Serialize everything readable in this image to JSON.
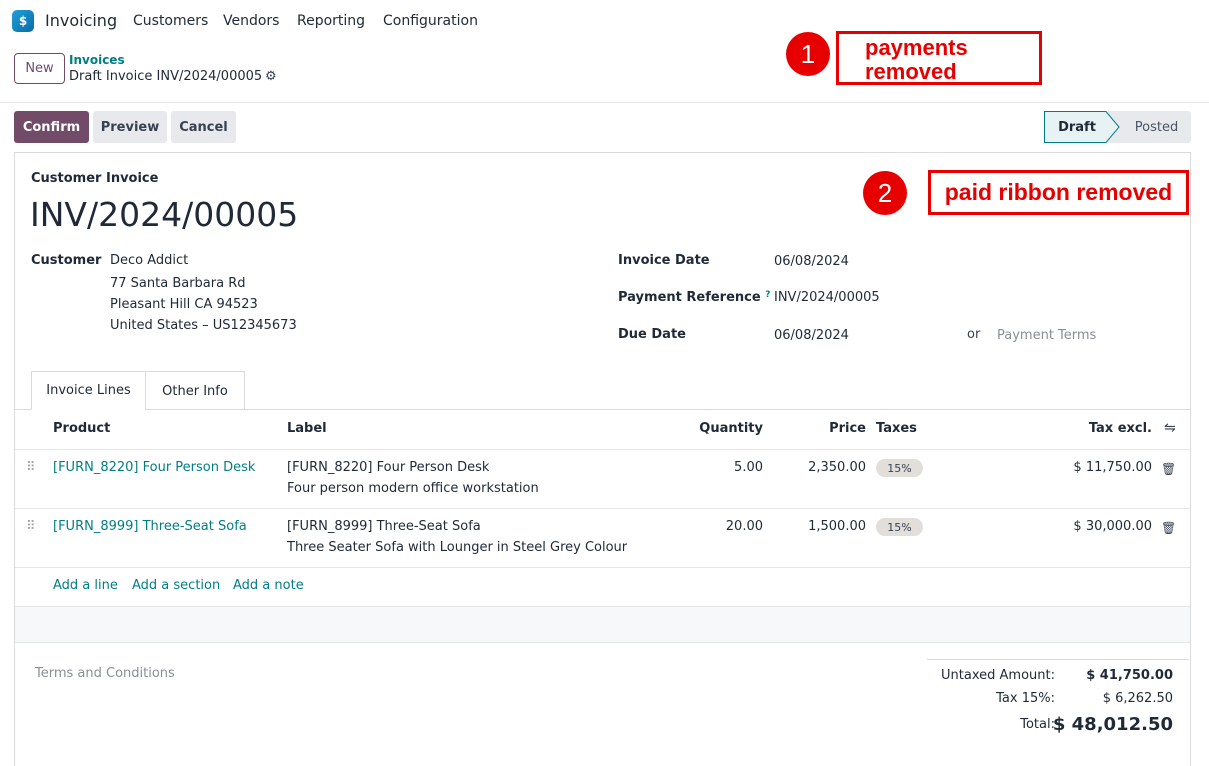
{
  "app": {
    "name": "Invoicing"
  },
  "menu": [
    "Customers",
    "Vendors",
    "Reporting",
    "Configuration"
  ],
  "control": {
    "new_label": "New",
    "breadcrumb_parent": "Invoices",
    "breadcrumb_current": "Draft Invoice INV/2024/00005"
  },
  "annotations": [
    {
      "number": "1",
      "text_line1": "payments",
      "text_line2": "removed"
    },
    {
      "number": "2",
      "text": "paid ribbon removed"
    }
  ],
  "actions": {
    "confirm": "Confirm",
    "preview": "Preview",
    "cancel": "Cancel"
  },
  "statusbar": {
    "draft": "Draft",
    "posted": "Posted",
    "active": "Draft"
  },
  "invoice": {
    "type": "Customer Invoice",
    "number": "INV/2024/00005",
    "customer_label": "Customer",
    "customer_name": "Deco Addict",
    "address_line1": "77 Santa Barbara Rd",
    "address_line2": "Pleasant Hill CA 94523",
    "address_line3": "United States – US12345673",
    "invoice_date_label": "Invoice Date",
    "invoice_date": "06/08/2024",
    "payment_ref_label": "Payment Reference",
    "payment_ref_help": "?",
    "payment_ref": "INV/2024/00005",
    "due_date_label": "Due Date",
    "due_date": "06/08/2024",
    "or_text": "or",
    "payment_terms_placeholder": "Payment Terms"
  },
  "tabs": [
    "Invoice Lines",
    "Other Info"
  ],
  "table": {
    "headers": {
      "product": "Product",
      "label": "Label",
      "quantity": "Quantity",
      "price": "Price",
      "taxes": "Taxes",
      "tax_excl": "Tax excl."
    },
    "rows": [
      {
        "product": "[FURN_8220] Four Person Desk",
        "label_line1": "[FURN_8220] Four Person Desk",
        "label_line2": "Four person modern office workstation",
        "quantity": "5.00",
        "price": "2,350.00",
        "tax": "15%",
        "subtotal": "$ 11,750.00"
      },
      {
        "product": "[FURN_8999] Three-Seat Sofa",
        "label_line1": "[FURN_8999] Three-Seat Sofa",
        "label_line2": "Three Seater Sofa with Lounger in Steel Grey Colour",
        "quantity": "20.00",
        "price": "1,500.00",
        "tax": "15%",
        "subtotal": "$ 30,000.00"
      }
    ],
    "add_line": "Add a line",
    "add_section": "Add a section",
    "add_note": "Add a note"
  },
  "footer": {
    "terms_placeholder": "Terms and Conditions",
    "untaxed_label": "Untaxed Amount:",
    "untaxed_value": "$ 41,750.00",
    "tax_label": "Tax 15%:",
    "tax_value": "$ 6,262.50",
    "total_label": "Total:",
    "total_value": "$ 48,012.50"
  },
  "colors": {
    "brand": "#714b67",
    "link": "#017e84",
    "annotation": "#e60000"
  }
}
